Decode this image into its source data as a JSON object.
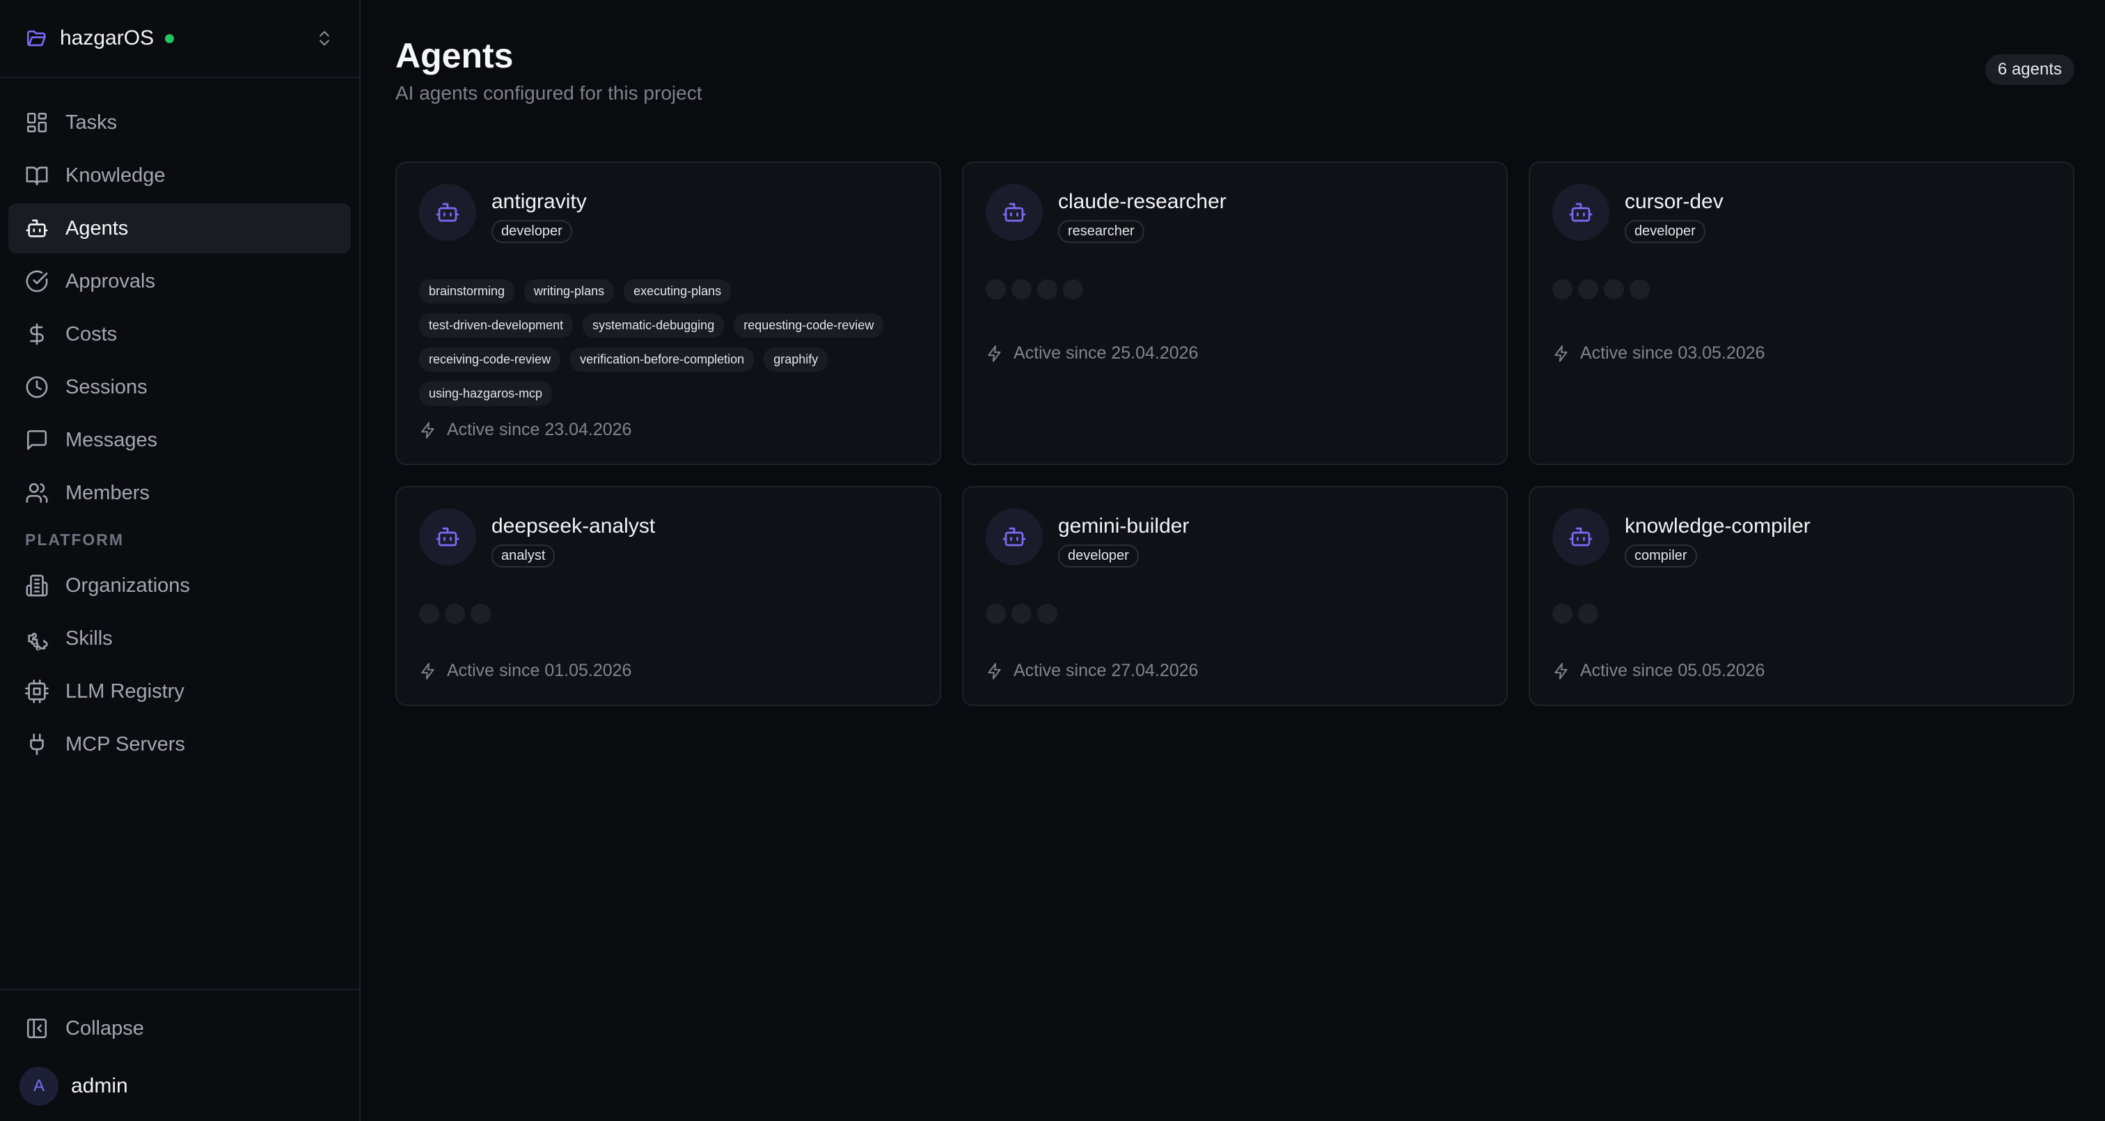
{
  "sidebar": {
    "org_name": "hazgarOS",
    "nav": {
      "tasks": "Tasks",
      "knowledge": "Knowledge",
      "agents": "Agents",
      "approvals": "Approvals",
      "costs": "Costs",
      "sessions": "Sessions",
      "messages": "Messages",
      "members": "Members"
    },
    "platform_label": "PLATFORM",
    "platform": {
      "organizations": "Organizations",
      "skills": "Skills",
      "llm_registry": "LLM Registry",
      "mcp_servers": "MCP Servers"
    },
    "collapse_label": "Collapse",
    "user": {
      "initial": "A",
      "name": "admin"
    }
  },
  "page": {
    "title": "Agents",
    "subtitle": "AI agents configured for this project",
    "count_badge": "6 agents"
  },
  "agents": [
    {
      "name": "antigravity",
      "role": "developer",
      "tags": [
        "brainstorming",
        "writing-plans",
        "executing-plans",
        "test-driven-development",
        "systematic-debugging",
        "requesting-code-review",
        "receiving-code-review",
        "verification-before-completion",
        "graphify",
        "using-hazgaros-mcp"
      ],
      "active": "Active since 23.04.2026"
    },
    {
      "name": "claude-researcher",
      "role": "researcher",
      "placeholder_count": 4,
      "active": "Active since 25.04.2026"
    },
    {
      "name": "cursor-dev",
      "role": "developer",
      "placeholder_count": 4,
      "active": "Active since 03.05.2026"
    },
    {
      "name": "deepseek-analyst",
      "role": "analyst",
      "placeholder_count": 3,
      "active": "Active since 01.05.2026"
    },
    {
      "name": "gemini-builder",
      "role": "developer",
      "placeholder_count": 3,
      "active": "Active since 27.04.2026"
    },
    {
      "name": "knowledge-compiler",
      "role": "compiler",
      "placeholder_count": 2,
      "active": "Active since 05.05.2026"
    }
  ],
  "colors": {
    "accent": "#7b6cf6",
    "status_online": "#22c55e",
    "background": "#0a0b0f",
    "card": "#101116"
  }
}
